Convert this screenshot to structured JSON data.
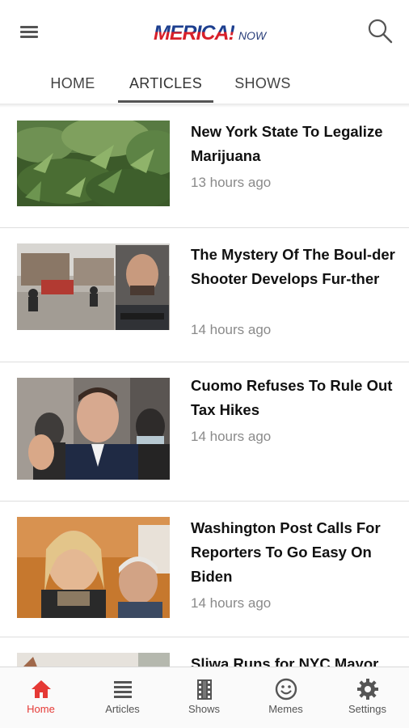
{
  "header": {
    "logo_main": "MERICA!",
    "logo_sub": "NOW",
    "menu_icon": "hamburger-menu-icon",
    "search_icon": "search-icon"
  },
  "tabs": [
    {
      "label": "HOME",
      "active": false
    },
    {
      "label": "ARTICLES",
      "active": true
    },
    {
      "label": "SHOWS",
      "active": false
    }
  ],
  "articles": [
    {
      "title": "New York State To Legalize Marijuana",
      "time": "13 hours ago",
      "image": "cannabis-plants-photo"
    },
    {
      "title": "The Mystery Of The Boul-der Shooter Develops Fur-ther",
      "time": "14 hours ago",
      "image": "boulder-scene-and-mugshot-photo"
    },
    {
      "title": "Cuomo Refuses To Rule Out Tax Hikes",
      "time": "14 hours ago",
      "image": "cuomo-speaking-photo"
    },
    {
      "title": "Washington Post Calls For Reporters To Go Easy On Biden",
      "time": "14 hours ago",
      "image": "reporters-photo"
    },
    {
      "title": "Sliwa Runs for NYC Mayor",
      "time": "",
      "image": "street-photo"
    }
  ],
  "bottom_nav": [
    {
      "label": "Home",
      "icon": "home-icon",
      "active": true
    },
    {
      "label": "Articles",
      "icon": "list-icon",
      "active": false
    },
    {
      "label": "Shows",
      "icon": "film-icon",
      "active": false
    },
    {
      "label": "Memes",
      "icon": "smiley-icon",
      "active": false
    },
    {
      "label": "Settings",
      "icon": "gear-icon",
      "active": false
    }
  ],
  "colors": {
    "accent_active": "#e53935",
    "logo_blue": "#1d3f8f",
    "logo_red": "#d8202a",
    "text_muted": "#8a8a8a"
  }
}
